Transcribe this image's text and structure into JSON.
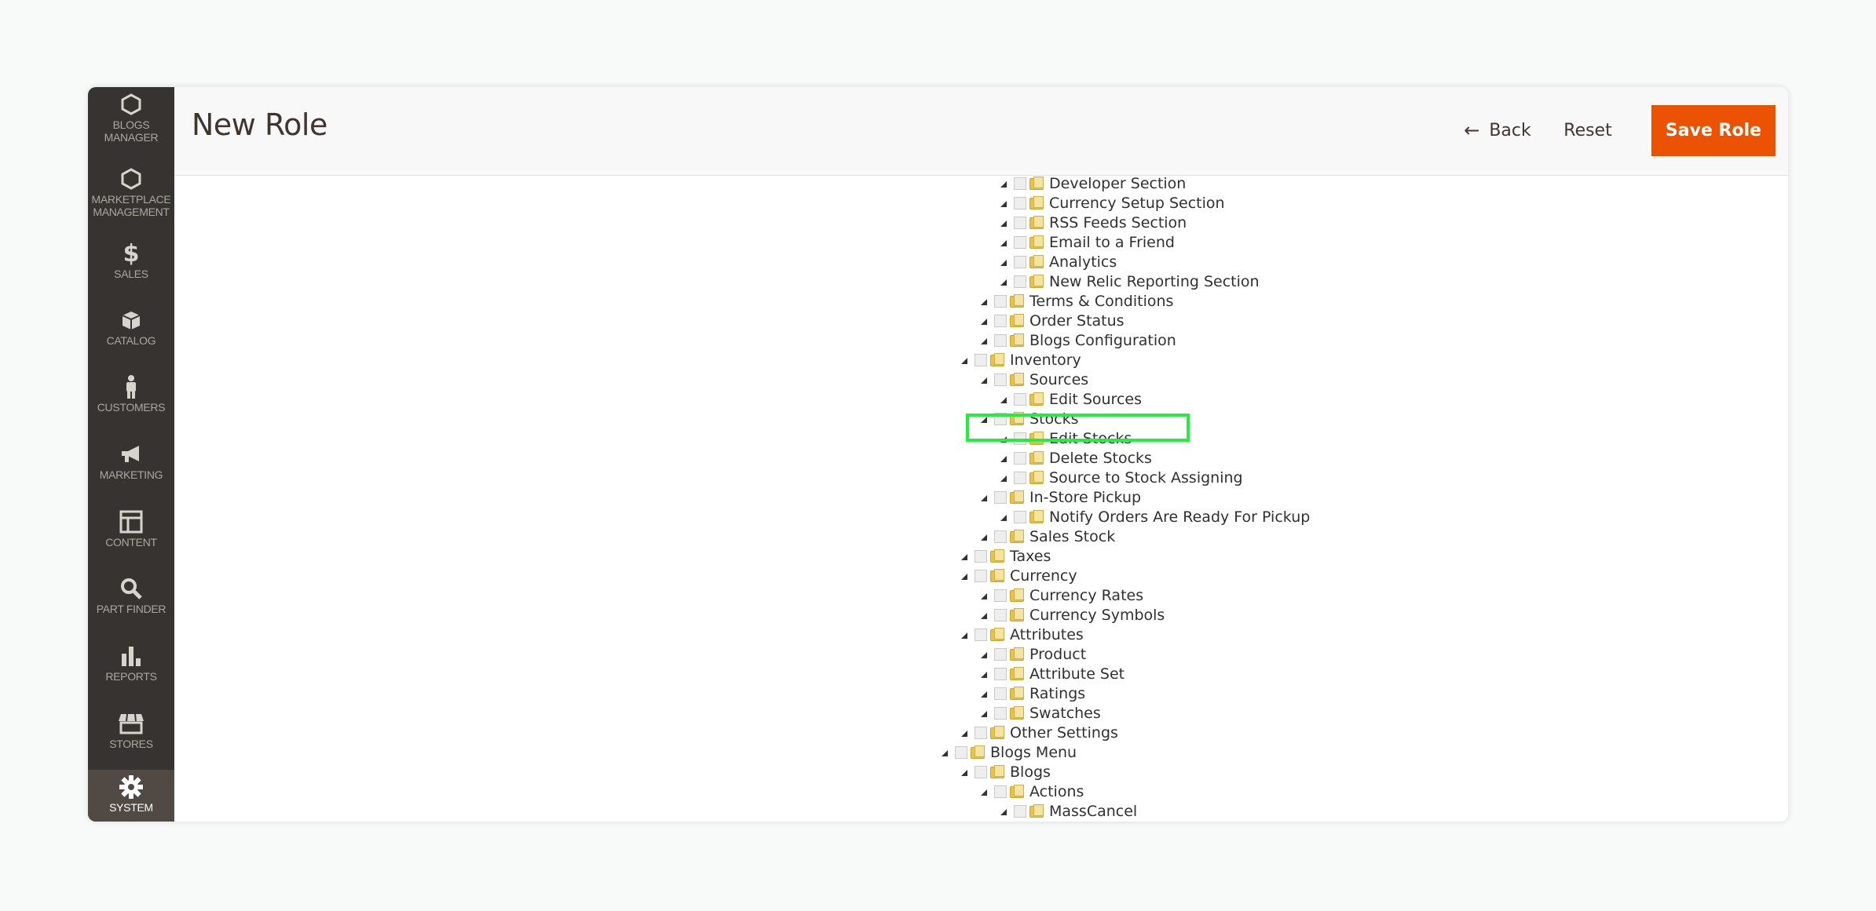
{
  "sidebar": {
    "items": [
      {
        "label": "BLOGS MANAGER",
        "icon": "hexagon-icon"
      },
      {
        "label": "MARKETPLACE MANAGEMENT",
        "icon": "hexagon-icon"
      },
      {
        "label": "SALES",
        "icon": "dollar-icon"
      },
      {
        "label": "CATALOG",
        "icon": "box-icon"
      },
      {
        "label": "CUSTOMERS",
        "icon": "person-icon"
      },
      {
        "label": "MARKETING",
        "icon": "megaphone-icon"
      },
      {
        "label": "CONTENT",
        "icon": "layout-icon"
      },
      {
        "label": "PART FINDER",
        "icon": "search-icon"
      },
      {
        "label": "REPORTS",
        "icon": "bar-chart-icon"
      },
      {
        "label": "STORES",
        "icon": "store-icon"
      },
      {
        "label": "SYSTEM",
        "icon": "gear-icon"
      }
    ]
  },
  "header": {
    "title": "New Role",
    "back_label": "Back",
    "reset_label": "Reset",
    "save_label": "Save Role"
  },
  "tree": [
    "Developer Section",
    "Currency Setup Section",
    "RSS Feeds Section",
    "Email to a Friend",
    "Analytics",
    "New Relic Reporting Section",
    "Terms & Conditions",
    "Order Status",
    "Blogs Configuration",
    "Inventory",
    "Sources",
    "Edit Sources",
    "Stocks",
    "Edit Stocks",
    "Delete Stocks",
    "Source to Stock Assigning",
    "In-Store Pickup",
    "Notify Orders Are Ready For Pickup",
    "Sales Stock",
    "Taxes",
    "Currency",
    "Currency Rates",
    "Currency Symbols",
    "Attributes",
    "Product",
    "Attribute Set",
    "Ratings",
    "Swatches",
    "Other Settings",
    "Blogs Menu",
    "Blogs",
    "Actions",
    "MassCancel"
  ],
  "colors": {
    "accent": "#eb5202",
    "sidebar": "#373330",
    "highlight_green": "#1ef03c",
    "highlight_cyan": "#7ff1f4"
  }
}
